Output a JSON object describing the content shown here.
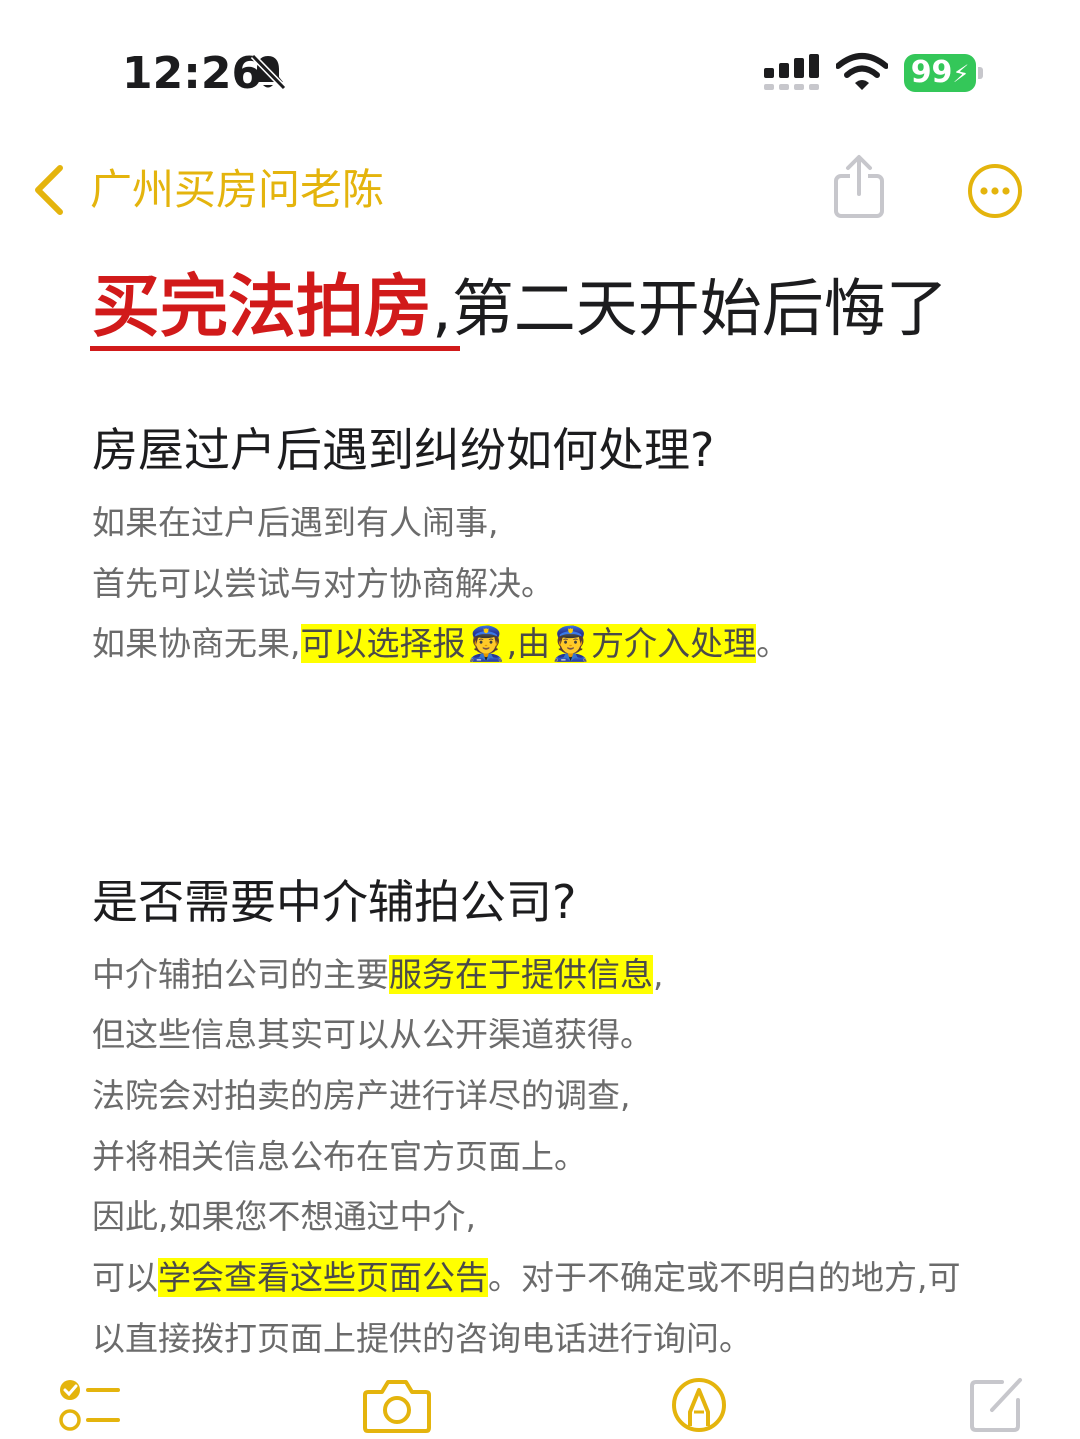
{
  "status_bar": {
    "time": "12:26",
    "battery": "99",
    "icons": [
      "bell-slash-icon",
      "cellular-signal-icon",
      "wifi-icon",
      "battery-charging-icon"
    ]
  },
  "nav": {
    "back_label": "广州买房问老陈",
    "accent_color": "#e4b40d"
  },
  "note": {
    "title_highlight": "买完法拍房",
    "title_rest": ",第二天开始后悔了",
    "section1": {
      "heading": "房屋过户后遇到纠纷如何处理?",
      "line1": "如果在过户后遇到有人闹事,",
      "line2": "首先可以尝试与对方协商解决。",
      "line3_pre": "如果协商无果,",
      "line3_hl": "可以选择报👮,由👮方介入处理",
      "line3_post": "。"
    },
    "section2": {
      "heading": "是否需要中介辅拍公司?",
      "line1_pre": "中介辅拍公司的主要",
      "line1_hl": "服务在于提供信息",
      "line1_post": ",",
      "line2": "但这些信息其实可以从公开渠道获得。",
      "line3": "法院会对拍卖的房产进行详尽的调查,",
      "line4": "并将相关信息公布在官方页面上。",
      "line5": "因此,如果您不想通过中介,",
      "line6_pre": "可以",
      "line6_hl": "学会查看这些页面公告",
      "line6_post": "。对于不确定或不明白的地方,可",
      "line7": "以直接拨打页面上提供的咨询电话进行询问。"
    }
  },
  "colors": {
    "title_red": "#d11a1a",
    "highlight": "#ffff00",
    "battery_green": "#34c759"
  },
  "toolbar": {
    "icons": [
      "checklist-icon",
      "camera-icon",
      "markup-pen-icon",
      "compose-icon"
    ]
  }
}
